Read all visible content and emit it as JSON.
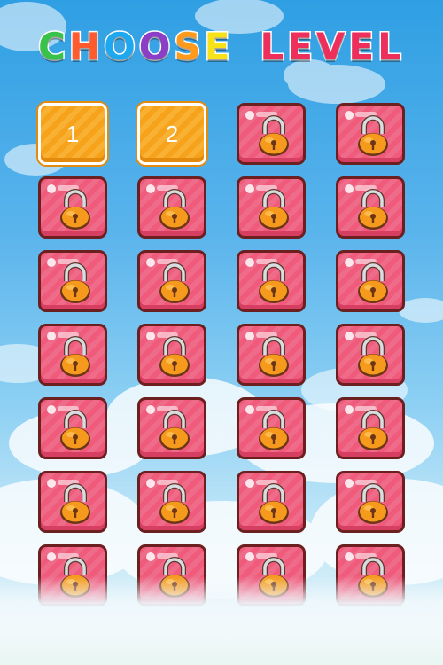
{
  "screen": {
    "title_letters": [
      {
        "ch": "C",
        "color": "#38c24a"
      },
      {
        "ch": "H",
        "color": "#ff5b2e"
      },
      {
        "ch": "O",
        "color": "#1ea8f0"
      },
      {
        "ch": "O",
        "color": "#8a3fc6"
      },
      {
        "ch": "S",
        "color": "#ff9a1a"
      },
      {
        "ch": "E",
        "color": "#f7e21a"
      }
    ],
    "title_word2": "LEVEL",
    "title_word2_color": "#ee2f5c"
  },
  "levels": [
    {
      "label": "1",
      "state": "unlocked"
    },
    {
      "label": "2",
      "state": "unlocked"
    },
    {
      "label": "",
      "state": "locked"
    },
    {
      "label": "",
      "state": "locked"
    },
    {
      "label": "",
      "state": "locked"
    },
    {
      "label": "",
      "state": "locked"
    },
    {
      "label": "",
      "state": "locked"
    },
    {
      "label": "",
      "state": "locked"
    },
    {
      "label": "",
      "state": "locked"
    },
    {
      "label": "",
      "state": "locked"
    },
    {
      "label": "",
      "state": "locked"
    },
    {
      "label": "",
      "state": "locked"
    },
    {
      "label": "",
      "state": "locked"
    },
    {
      "label": "",
      "state": "locked"
    },
    {
      "label": "",
      "state": "locked"
    },
    {
      "label": "",
      "state": "locked"
    },
    {
      "label": "",
      "state": "locked"
    },
    {
      "label": "",
      "state": "locked"
    },
    {
      "label": "",
      "state": "locked"
    },
    {
      "label": "",
      "state": "locked"
    },
    {
      "label": "",
      "state": "locked"
    },
    {
      "label": "",
      "state": "locked"
    },
    {
      "label": "",
      "state": "locked"
    },
    {
      "label": "",
      "state": "locked"
    },
    {
      "label": "",
      "state": "locked"
    },
    {
      "label": "",
      "state": "locked"
    },
    {
      "label": "",
      "state": "locked"
    },
    {
      "label": "",
      "state": "locked"
    }
  ],
  "icons": {
    "locked": "padlock-icon"
  }
}
